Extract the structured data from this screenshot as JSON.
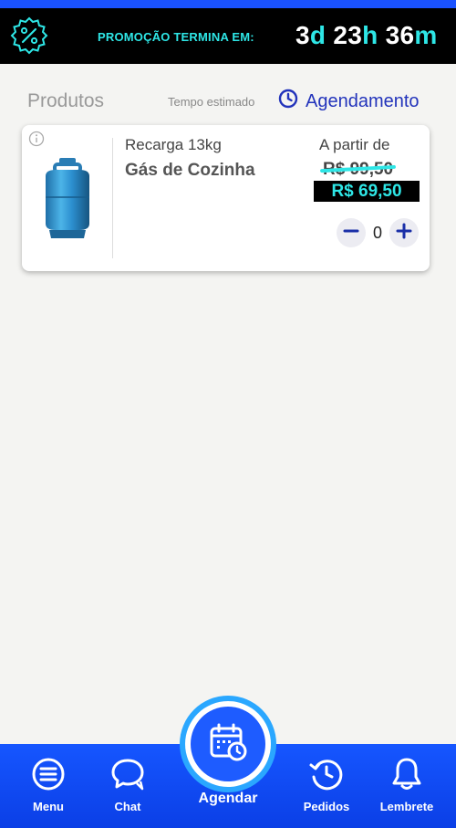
{
  "promo": {
    "text": "PROMOÇÃO TERMINA EM:",
    "days": "3",
    "days_unit": "d",
    "hours": "23",
    "hours_unit": "h",
    "minutes": "36",
    "minutes_unit": "m",
    "badge_icon": "percent-badge-icon"
  },
  "header": {
    "title": "Produtos",
    "estimated_label": "Tempo estimado",
    "schedule_label": "Agendamento",
    "schedule_icon": "clock-icon"
  },
  "product": {
    "subtitle": "Recarga 13kg",
    "name": "Gás de Cozinha",
    "from_label": "A partir de",
    "old_price": "R$ 99,50",
    "new_price": "R$ 69,50",
    "quantity": "0",
    "image_icon": "gas-cylinder-icon",
    "info_icon": "info-icon"
  },
  "bottom_nav": {
    "menu_label": "Menu",
    "chat_label": "Chat",
    "schedule_label": "Agendar",
    "orders_label": "Pedidos",
    "reminder_label": "Lembrete"
  },
  "colors": {
    "accent_cyan": "#2ee6e6",
    "brand_blue": "#1656ff",
    "link_blue": "#2233bb"
  }
}
